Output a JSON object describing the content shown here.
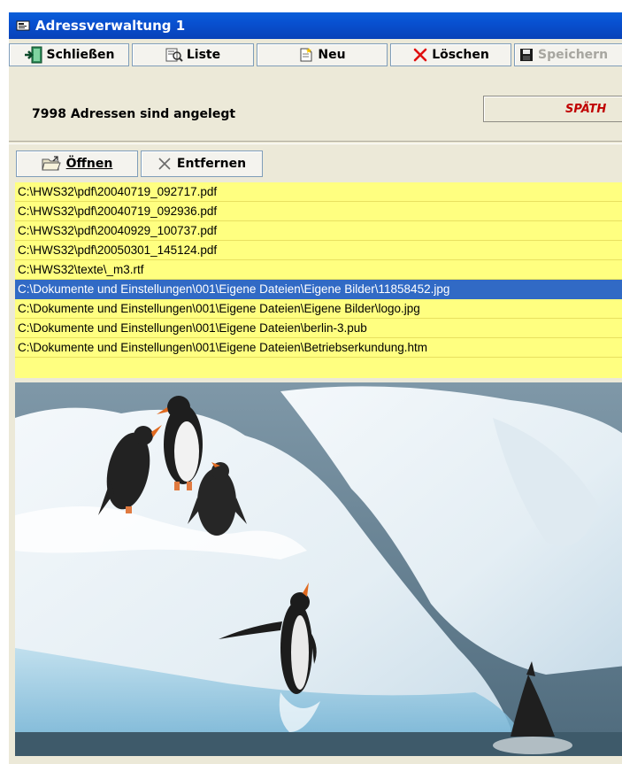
{
  "window": {
    "title": "Adressverwaltung 1"
  },
  "toolbar": {
    "close_label": "Schließen",
    "list_label": "Liste",
    "new_label": "Neu",
    "delete_label": "Löschen",
    "save_label": "Speichern"
  },
  "status": {
    "address_count": "7998 Adressen sind angelegt",
    "name_value": "SPÄTH"
  },
  "files_toolbar": {
    "open_label": "Öffnen",
    "remove_label": "Entfernen"
  },
  "files": [
    "C:\\HWS32\\pdf\\20040719_092717.pdf",
    "C:\\HWS32\\pdf\\20040719_092936.pdf",
    "C:\\HWS32\\pdf\\20040929_100737.pdf",
    "C:\\HWS32\\pdf\\20050301_145124.pdf",
    "C:\\HWS32\\texte\\_m3.rtf",
    "C:\\Dokumente und Einstellungen\\001\\Eigene Dateien\\Eigene Bilder\\11858452.jpg",
    "C:\\Dokumente und Einstellungen\\001\\Eigene Dateien\\Eigene Bilder\\logo.jpg",
    "C:\\Dokumente und Einstellungen\\001\\Eigene Dateien\\berlin-3.pub",
    "C:\\Dokumente und Einstellungen\\001\\Eigene Dateien\\Betriebserkundung.htm"
  ],
  "selected_file_index": 5,
  "colors": {
    "list_background": "#ffff80",
    "selection": "#316ac5",
    "title_bar": "#0850d0",
    "name_text": "#c00000"
  }
}
